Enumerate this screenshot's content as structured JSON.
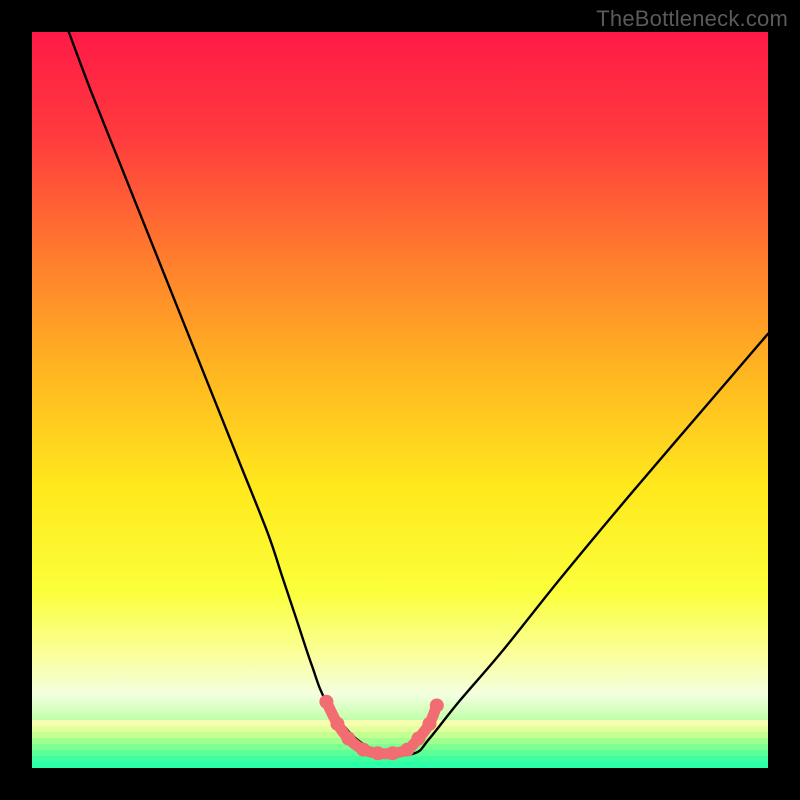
{
  "watermark": "TheBottleneck.com",
  "gradient": {
    "stops": [
      {
        "pct": 0,
        "color": "#ff1a47"
      },
      {
        "pct": 14,
        "color": "#ff3a3e"
      },
      {
        "pct": 30,
        "color": "#ff7a2e"
      },
      {
        "pct": 46,
        "color": "#ffb521"
      },
      {
        "pct": 62,
        "color": "#ffe91d"
      },
      {
        "pct": 76,
        "color": "#fbff3a"
      },
      {
        "pct": 85,
        "color": "#faffa0"
      },
      {
        "pct": 90,
        "color": "#f3ffe0"
      },
      {
        "pct": 93,
        "color": "#c8ffb0"
      },
      {
        "pct": 96,
        "color": "#80ff96"
      },
      {
        "pct": 100,
        "color": "#2bffa8"
      }
    ]
  },
  "stripes": [
    "#f6ffb0",
    "#e2ff9e",
    "#c4ff92",
    "#a0ff8e",
    "#7dff92",
    "#5cff98",
    "#3effa0",
    "#2bffa8"
  ],
  "chart_data": {
    "type": "line",
    "title": "",
    "xlabel": "",
    "ylabel": "",
    "xlim": [
      0,
      100
    ],
    "ylim": [
      0,
      100
    ],
    "series": [
      {
        "name": "black-curve",
        "x": [
          5,
          8,
          12,
          16,
          20,
          24,
          28,
          32,
          34,
          36,
          38,
          40,
          44,
          48,
          52,
          54,
          58,
          64,
          72,
          82,
          94,
          100
        ],
        "values": [
          100,
          92,
          82,
          72,
          62,
          52,
          42,
          32,
          26,
          20,
          14,
          9,
          4,
          2,
          2,
          4,
          9,
          16,
          26,
          38,
          52,
          59
        ]
      },
      {
        "name": "pink-overlay",
        "x": [
          40,
          41.5,
          43,
          45,
          47,
          49,
          51,
          52.5,
          54,
          55
        ],
        "values": [
          9,
          6,
          4,
          2.5,
          2,
          2,
          2.5,
          4,
          6,
          8.5
        ]
      }
    ],
    "markers": {
      "name": "pink-dots",
      "x": [
        40,
        41.5,
        43,
        45,
        47,
        49,
        51,
        52.5,
        54,
        55
      ],
      "values": [
        9,
        6,
        4,
        2.5,
        2,
        2,
        2.5,
        4,
        6,
        8.5
      ]
    }
  }
}
